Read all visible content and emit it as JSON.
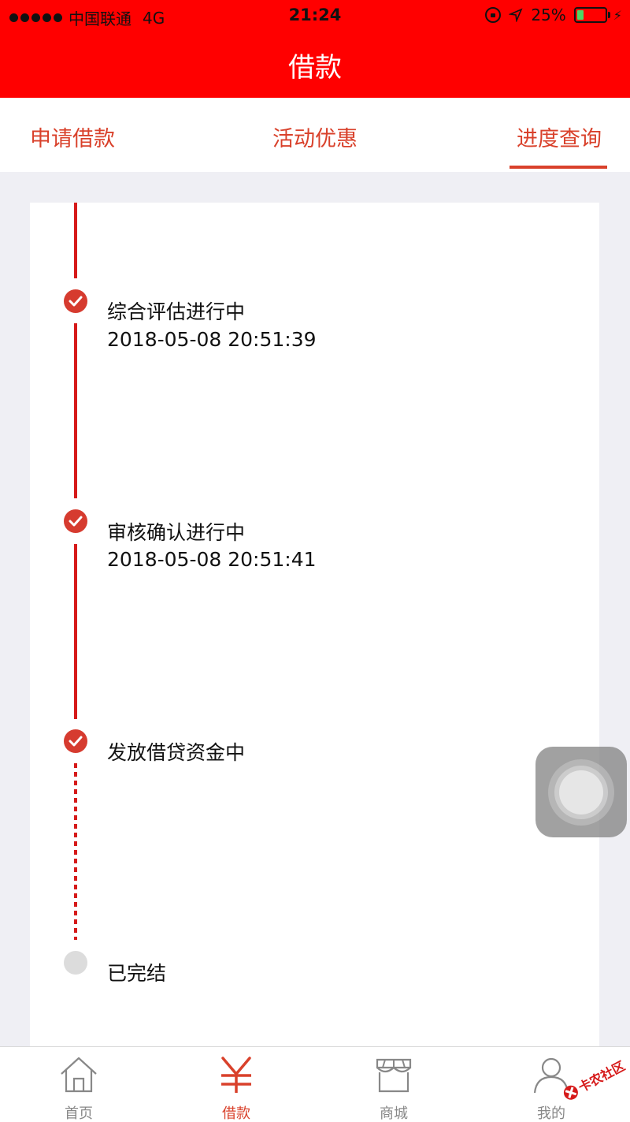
{
  "status_bar": {
    "carrier": "中国联通",
    "network": "4G",
    "time": "21:24",
    "battery": "25%",
    "battery_level": 0.25
  },
  "header": {
    "title": "借款"
  },
  "tabs": [
    {
      "label": "申请借款",
      "active": false
    },
    {
      "label": "活动优惠",
      "active": false
    },
    {
      "label": "进度查询",
      "active": true
    }
  ],
  "steps": [
    {
      "title": "综合评估进行中",
      "time": "2018-05-08 20:51:39",
      "status": "done"
    },
    {
      "title": "审核确认进行中",
      "time": "2018-05-08 20:51:41",
      "status": "done"
    },
    {
      "title": "发放借贷资金中",
      "time": "",
      "status": "done"
    },
    {
      "title": "已完结",
      "time": "",
      "status": "pending"
    }
  ],
  "tabbar": [
    {
      "label": "首页",
      "icon": "home-icon",
      "active": false
    },
    {
      "label": "借款",
      "icon": "yen-icon",
      "active": true
    },
    {
      "label": "商城",
      "icon": "store-icon",
      "active": false
    },
    {
      "label": "我的",
      "icon": "user-icon",
      "active": false
    }
  ],
  "watermark": {
    "text": "卡农社区"
  },
  "colors": {
    "header_bg": "#ff0000",
    "accent": "#d9412b",
    "timeline": "#d61a1a",
    "page_bg": "#efeff4"
  }
}
